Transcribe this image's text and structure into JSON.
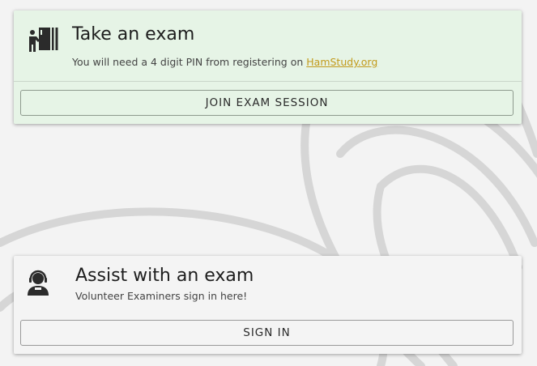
{
  "take_exam": {
    "title": "Take an exam",
    "subtitle_prefix": "You will need a 4 digit PIN from registering on ",
    "link_text": "HamStudy.org",
    "button_label": "JOIN EXAM SESSION",
    "icon": "exam-board-person-icon"
  },
  "assist_exam": {
    "title": "Assist with an exam",
    "subtitle": "Volunteer Examiners sign in here!",
    "button_label": "SIGN IN",
    "icon": "headset-user-icon"
  },
  "colors": {
    "take_card_bg": "#e6f4e6",
    "assist_card_bg": "#f4f4f4",
    "link": "#c29a1b",
    "page_bg": "#f3f3f3"
  }
}
